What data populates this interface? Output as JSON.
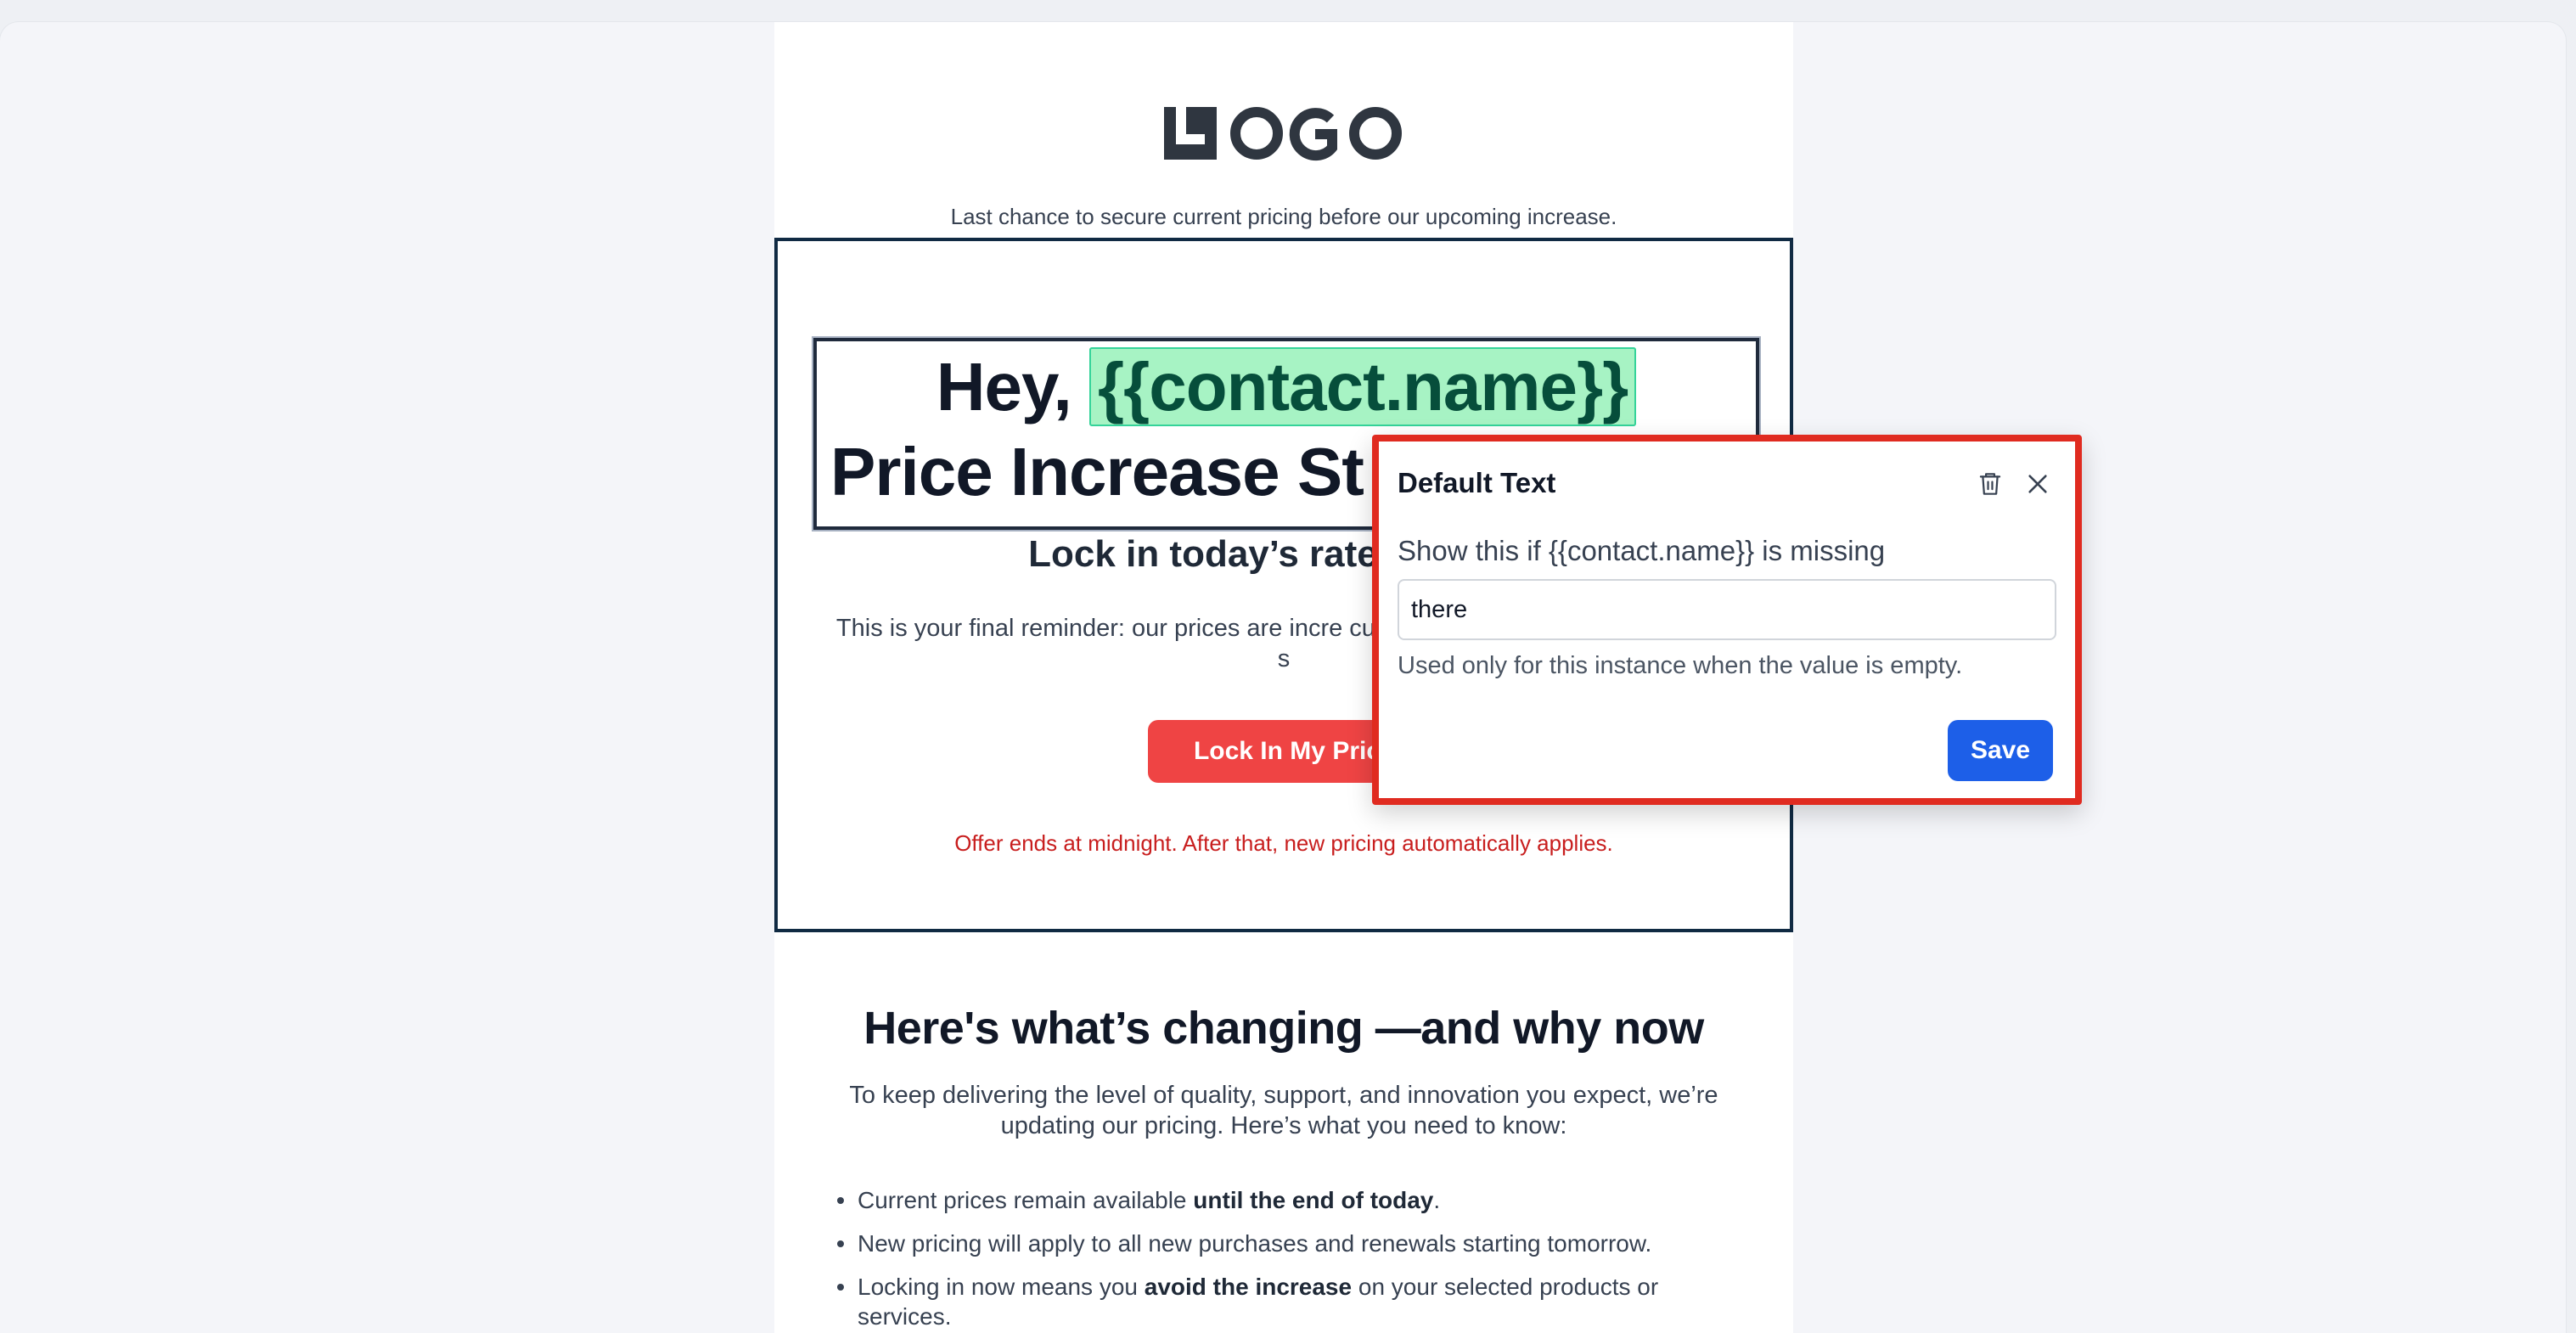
{
  "colors": {
    "page_bg": "#f4f5f9",
    "hero_border": "#102a43",
    "token_bg": "#a7f3c4",
    "cta_bg": "#ef4444",
    "offer_text": "#c81e1e",
    "popover_border": "#e02b20",
    "save_bg": "#1d5fe8"
  },
  "email": {
    "logo_text": "LOGO",
    "preheader": "Last chance to secure current pricing before our upcoming increase.",
    "hero": {
      "headline_prefix": "Hey,",
      "headline_token": "{{contact.name}}",
      "headline_line2": "Price Increase St",
      "subhead": "Lock in today’s rates before t",
      "body": "This is your final reminder: our prices are incre current pricing on our products and s",
      "cta_label": "Lock In My Pric",
      "offer_note": "Offer ends at midnight. After that, new pricing automatically applies."
    },
    "section": {
      "title": "Here's what’s changing —and why now",
      "intro": "To keep delivering the level of quality, support, and innovation you expect, we’re updating our pricing. Here’s what you need to know:",
      "bullets": [
        {
          "before": "Current prices remain available ",
          "bold": "until the end of today",
          "after": "."
        },
        {
          "before": "New pricing will apply to all new purchases and renewals starting tomorrow.",
          "bold": "",
          "after": ""
        },
        {
          "before": "Locking in now means you ",
          "bold": "avoid the increase",
          "after": " on your selected products or services."
        }
      ]
    }
  },
  "popover": {
    "title": "Default Text",
    "trash_icon": "trash-icon",
    "close_icon": "close-icon",
    "label": "Show this if {{contact.name}} is missing",
    "input_value": "there",
    "help_text": "Used only for this instance when the value is empty.",
    "save_label": "Save"
  }
}
